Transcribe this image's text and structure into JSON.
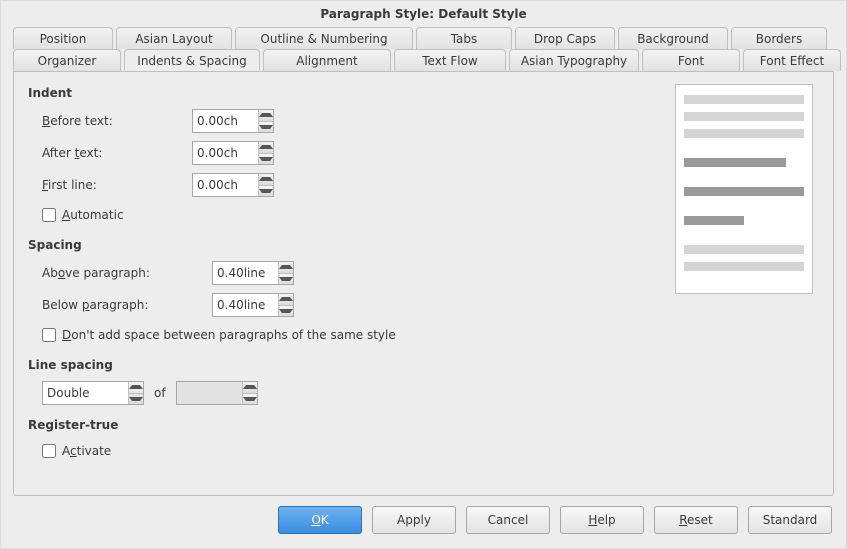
{
  "title": "Paragraph Style: Default Style",
  "tabs": {
    "row1": [
      "Position",
      "Asian Layout",
      "Outline & Numbering",
      "Tabs",
      "Drop Caps",
      "Background",
      "Borders"
    ],
    "row2": [
      "Organizer",
      "Indents & Spacing",
      "Alignment",
      "Text Flow",
      "Asian Typography",
      "Font",
      "Font Effect"
    ],
    "active": "Indents & Spacing"
  },
  "indent": {
    "heading": "Indent",
    "before_label_pre": "",
    "before_u": "B",
    "before_label_post": "efore text:",
    "before_value": "0.00ch",
    "after_label_pre": "After ",
    "after_u": "t",
    "after_label_post": "ext:",
    "after_value": "0.00ch",
    "first_u": "F",
    "first_label_post": "irst line:",
    "first_value": "0.00ch",
    "auto_u": "A",
    "auto_label_post": "utomatic"
  },
  "spacing": {
    "heading": "Spacing",
    "above_label_pre": "Ab",
    "above_u": "o",
    "above_label_post": "ve paragraph:",
    "above_value": "0.40line",
    "below_label_pre": "Below ",
    "below_u": "p",
    "below_label_post": "aragraph:",
    "below_value": "0.40line",
    "same_u": "D",
    "same_label_post": "on't add space between paragraphs of the same style"
  },
  "linespacing": {
    "heading": "Line spacing",
    "value": "Double",
    "of_label": "of",
    "of_value": ""
  },
  "register": {
    "heading": "Register-true",
    "activate_pre": "A",
    "activate_u": "c",
    "activate_post": "tivate"
  },
  "buttons": {
    "ok_u": "O",
    "ok_post": "K",
    "apply": "Apply",
    "cancel": "Cancel",
    "help_u": "H",
    "help_post": "elp",
    "reset_u": "R",
    "reset_post": "eset",
    "standard": "Standard"
  }
}
